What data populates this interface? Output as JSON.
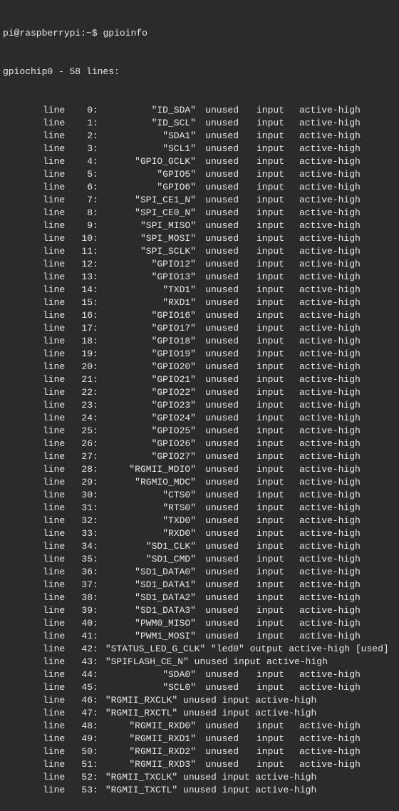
{
  "prompt": {
    "userhost": "pi@raspberrypi",
    "path": "~",
    "symbol": "$",
    "command": "gpioinfo"
  },
  "chip_line": "gpiochip0 - 58 lines:",
  "label_line": "line",
  "rows": [
    {
      "n": 0,
      "name": "\"ID_SDA\"",
      "used": "unused",
      "dir": "input",
      "act": "active-high",
      "fmt": "std"
    },
    {
      "n": 1,
      "name": "\"ID_SCL\"",
      "used": "unused",
      "dir": "input",
      "act": "active-high",
      "fmt": "std"
    },
    {
      "n": 2,
      "name": "\"SDA1\"",
      "used": "unused",
      "dir": "input",
      "act": "active-high",
      "fmt": "std"
    },
    {
      "n": 3,
      "name": "\"SCL1\"",
      "used": "unused",
      "dir": "input",
      "act": "active-high",
      "fmt": "std"
    },
    {
      "n": 4,
      "name": "\"GPIO_GCLK\"",
      "used": "unused",
      "dir": "input",
      "act": "active-high",
      "fmt": "std"
    },
    {
      "n": 5,
      "name": "\"GPIO5\"",
      "used": "unused",
      "dir": "input",
      "act": "active-high",
      "fmt": "std"
    },
    {
      "n": 6,
      "name": "\"GPIO6\"",
      "used": "unused",
      "dir": "input",
      "act": "active-high",
      "fmt": "std"
    },
    {
      "n": 7,
      "name": "\"SPI_CE1_N\"",
      "used": "unused",
      "dir": "input",
      "act": "active-high",
      "fmt": "std"
    },
    {
      "n": 8,
      "name": "\"SPI_CE0_N\"",
      "used": "unused",
      "dir": "input",
      "act": "active-high",
      "fmt": "std"
    },
    {
      "n": 9,
      "name": "\"SPI_MISO\"",
      "used": "unused",
      "dir": "input",
      "act": "active-high",
      "fmt": "std"
    },
    {
      "n": 10,
      "name": "\"SPI_MOSI\"",
      "used": "unused",
      "dir": "input",
      "act": "active-high",
      "fmt": "std"
    },
    {
      "n": 11,
      "name": "\"SPI_SCLK\"",
      "used": "unused",
      "dir": "input",
      "act": "active-high",
      "fmt": "std"
    },
    {
      "n": 12,
      "name": "\"GPIO12\"",
      "used": "unused",
      "dir": "input",
      "act": "active-high",
      "fmt": "std"
    },
    {
      "n": 13,
      "name": "\"GPIO13\"",
      "used": "unused",
      "dir": "input",
      "act": "active-high",
      "fmt": "std"
    },
    {
      "n": 14,
      "name": "\"TXD1\"",
      "used": "unused",
      "dir": "input",
      "act": "active-high",
      "fmt": "std"
    },
    {
      "n": 15,
      "name": "\"RXD1\"",
      "used": "unused",
      "dir": "input",
      "act": "active-high",
      "fmt": "std"
    },
    {
      "n": 16,
      "name": "\"GPIO16\"",
      "used": "unused",
      "dir": "input",
      "act": "active-high",
      "fmt": "std"
    },
    {
      "n": 17,
      "name": "\"GPIO17\"",
      "used": "unused",
      "dir": "input",
      "act": "active-high",
      "fmt": "std"
    },
    {
      "n": 18,
      "name": "\"GPIO18\"",
      "used": "unused",
      "dir": "input",
      "act": "active-high",
      "fmt": "std"
    },
    {
      "n": 19,
      "name": "\"GPIO19\"",
      "used": "unused",
      "dir": "input",
      "act": "active-high",
      "fmt": "std"
    },
    {
      "n": 20,
      "name": "\"GPIO20\"",
      "used": "unused",
      "dir": "input",
      "act": "active-high",
      "fmt": "std"
    },
    {
      "n": 21,
      "name": "\"GPIO21\"",
      "used": "unused",
      "dir": "input",
      "act": "active-high",
      "fmt": "std"
    },
    {
      "n": 22,
      "name": "\"GPIO22\"",
      "used": "unused",
      "dir": "input",
      "act": "active-high",
      "fmt": "std"
    },
    {
      "n": 23,
      "name": "\"GPIO23\"",
      "used": "unused",
      "dir": "input",
      "act": "active-high",
      "fmt": "std"
    },
    {
      "n": 24,
      "name": "\"GPIO24\"",
      "used": "unused",
      "dir": "input",
      "act": "active-high",
      "fmt": "std"
    },
    {
      "n": 25,
      "name": "\"GPIO25\"",
      "used": "unused",
      "dir": "input",
      "act": "active-high",
      "fmt": "std"
    },
    {
      "n": 26,
      "name": "\"GPIO26\"",
      "used": "unused",
      "dir": "input",
      "act": "active-high",
      "fmt": "std"
    },
    {
      "n": 27,
      "name": "\"GPIO27\"",
      "used": "unused",
      "dir": "input",
      "act": "active-high",
      "fmt": "std"
    },
    {
      "n": 28,
      "name": "\"RGMII_MDIO\"",
      "used": "unused",
      "dir": "input",
      "act": "active-high",
      "fmt": "std"
    },
    {
      "n": 29,
      "name": "\"RGMIO_MDC\"",
      "used": "unused",
      "dir": "input",
      "act": "active-high",
      "fmt": "std"
    },
    {
      "n": 30,
      "name": "\"CTS0\"",
      "used": "unused",
      "dir": "input",
      "act": "active-high",
      "fmt": "std"
    },
    {
      "n": 31,
      "name": "\"RTS0\"",
      "used": "unused",
      "dir": "input",
      "act": "active-high",
      "fmt": "std"
    },
    {
      "n": 32,
      "name": "\"TXD0\"",
      "used": "unused",
      "dir": "input",
      "act": "active-high",
      "fmt": "std"
    },
    {
      "n": 33,
      "name": "\"RXD0\"",
      "used": "unused",
      "dir": "input",
      "act": "active-high",
      "fmt": "std"
    },
    {
      "n": 34,
      "name": "\"SD1_CLK\"",
      "used": "unused",
      "dir": "input",
      "act": "active-high",
      "fmt": "std"
    },
    {
      "n": 35,
      "name": "\"SD1_CMD\"",
      "used": "unused",
      "dir": "input",
      "act": "active-high",
      "fmt": "std"
    },
    {
      "n": 36,
      "name": "\"SD1_DATA0\"",
      "used": "unused",
      "dir": "input",
      "act": "active-high",
      "fmt": "std"
    },
    {
      "n": 37,
      "name": "\"SD1_DATA1\"",
      "used": "unused",
      "dir": "input",
      "act": "active-high",
      "fmt": "std"
    },
    {
      "n": 38,
      "name": "\"SD1_DATA2\"",
      "used": "unused",
      "dir": "input",
      "act": "active-high",
      "fmt": "std"
    },
    {
      "n": 39,
      "name": "\"SD1_DATA3\"",
      "used": "unused",
      "dir": "input",
      "act": "active-high",
      "fmt": "std"
    },
    {
      "n": 40,
      "name": "\"PWM0_MISO\"",
      "used": "unused",
      "dir": "input",
      "act": "active-high",
      "fmt": "std"
    },
    {
      "n": 41,
      "name": "\"PWM1_MOSI\"",
      "used": "unused",
      "dir": "input",
      "act": "active-high",
      "fmt": "std"
    },
    {
      "n": 42,
      "name": "\"STATUS_LED_G_CLK\"",
      "rest": " \"led0\" output active-high [used]",
      "fmt": "free"
    },
    {
      "n": 43,
      "name": "\"SPIFLASH_CE_N\"",
      "rest": " unused input active-high",
      "fmt": "free"
    },
    {
      "n": 44,
      "name": "\"SDA0\"",
      "used": "unused",
      "dir": "input",
      "act": "active-high",
      "fmt": "std"
    },
    {
      "n": 45,
      "name": "\"SCL0\"",
      "used": "unused",
      "dir": "input",
      "act": "active-high",
      "fmt": "std"
    },
    {
      "n": 46,
      "name": "\"RGMII_RXCLK\"",
      "rest": " unused input active-high",
      "fmt": "free"
    },
    {
      "n": 47,
      "name": "\"RGMII_RXCTL\"",
      "rest": " unused input active-high",
      "fmt": "free"
    },
    {
      "n": 48,
      "name": "\"RGMII_RXD0\"",
      "used": "unused",
      "dir": "input",
      "act": "active-high",
      "fmt": "std"
    },
    {
      "n": 49,
      "name": "\"RGMII_RXD1\"",
      "used": "unused",
      "dir": "input",
      "act": "active-high",
      "fmt": "std"
    },
    {
      "n": 50,
      "name": "\"RGMII_RXD2\"",
      "used": "unused",
      "dir": "input",
      "act": "active-high",
      "fmt": "std"
    },
    {
      "n": 51,
      "name": "\"RGMII_RXD3\"",
      "used": "unused",
      "dir": "input",
      "act": "active-high",
      "fmt": "std"
    },
    {
      "n": 52,
      "name": "\"RGMII_TXCLK\"",
      "rest": " unused input active-high",
      "fmt": "free"
    },
    {
      "n": 53,
      "name": "\"RGMII_TXCTL\"",
      "rest": " unused input active-high",
      "fmt": "free"
    }
  ]
}
